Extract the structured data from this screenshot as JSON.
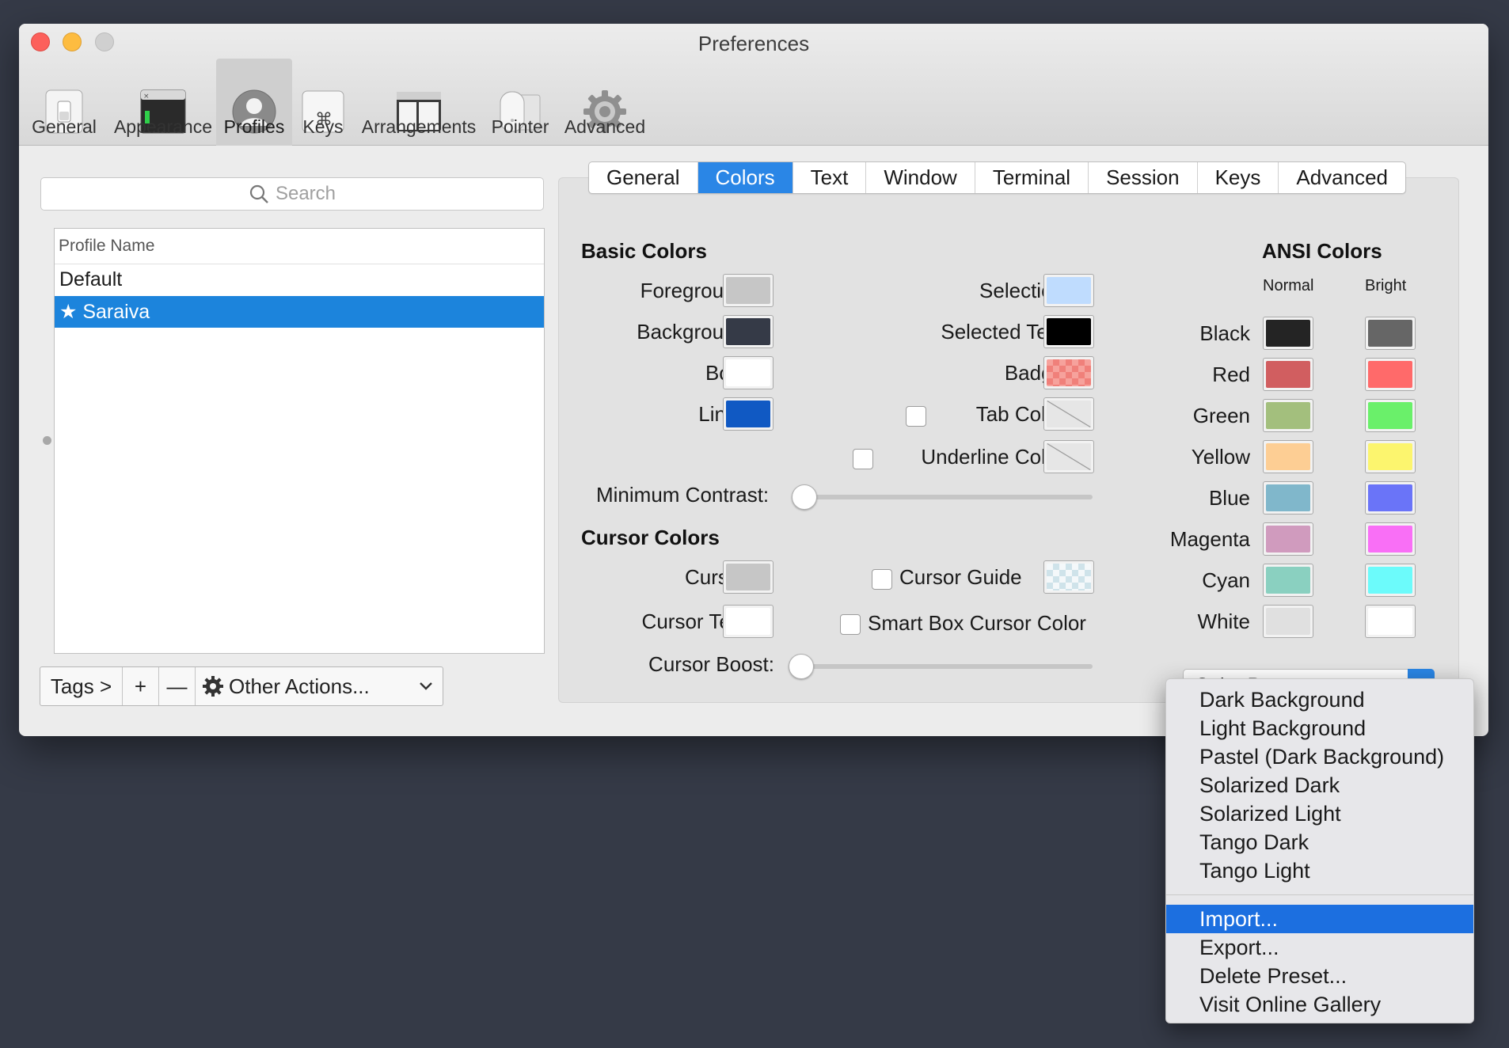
{
  "window": {
    "title": "Preferences"
  },
  "toolbar": [
    {
      "label": "General",
      "icon": "general-switch-icon"
    },
    {
      "label": "Appearance",
      "icon": "terminal-window-icon"
    },
    {
      "label": "Profiles",
      "icon": "user-silhouette-icon",
      "selected": true
    },
    {
      "label": "Keys",
      "icon": "command-key-icon"
    },
    {
      "label": "Arrangements",
      "icon": "window-arrangement-icon"
    },
    {
      "label": "Pointer",
      "icon": "mouse-icon"
    },
    {
      "label": "Advanced",
      "icon": "gear-icon"
    }
  ],
  "search": {
    "placeholder": "Search"
  },
  "profiles": {
    "header": "Profile Name",
    "rows": [
      {
        "name": "Default",
        "selected": false
      },
      {
        "name": "★ Saraiva",
        "selected": true
      }
    ]
  },
  "bottom_bar": {
    "tags": "Tags >",
    "add": "+",
    "remove": "—",
    "other_actions": "Other Actions..."
  },
  "tabs": [
    "General",
    "Colors",
    "Text",
    "Window",
    "Terminal",
    "Session",
    "Keys",
    "Advanced"
  ],
  "active_tab": "Colors",
  "basic_colors": {
    "title": "Basic Colors",
    "left": [
      {
        "label": "Foreground",
        "color": "#c6c6c6"
      },
      {
        "label": "Background",
        "color": "#353a47"
      },
      {
        "label": "Bold",
        "color": "#ffffff"
      },
      {
        "label": "Links",
        "color": "#1059c3"
      }
    ],
    "right": [
      {
        "label": "Selection",
        "color": "#bfdcfe"
      },
      {
        "label": "Selected Text",
        "color": "#000000"
      },
      {
        "label": "Badge",
        "color": "#f0807a",
        "pattern": "checker"
      },
      {
        "label": "Tab Color",
        "checkbox": true,
        "checked": false,
        "pattern": "none"
      },
      {
        "label": "Underline Color",
        "checkbox": true,
        "checked": false,
        "pattern": "none"
      }
    ],
    "min_contrast": {
      "label": "Minimum Contrast:",
      "value": 0
    }
  },
  "cursor_colors": {
    "title": "Cursor Colors",
    "cursor": {
      "label": "Cursor",
      "color": "#c6c6c6"
    },
    "cursor_text": {
      "label": "Cursor Text",
      "color": "#ffffff"
    },
    "cursor_guide": {
      "label": "Cursor Guide",
      "checked": false,
      "color": "#dcecf2",
      "pattern": "checker"
    },
    "smart_box": {
      "label": "Smart Box Cursor Color",
      "checked": false
    },
    "cursor_boost": {
      "label": "Cursor Boost:",
      "value": 0
    }
  },
  "ansi": {
    "title": "ANSI Colors",
    "col_normal": "Normal",
    "col_bright": "Bright",
    "rows": [
      {
        "name": "Black",
        "normal": "#242424",
        "bright": "#666666"
      },
      {
        "name": "Red",
        "normal": "#d15e60",
        "bright": "#ff6a6a"
      },
      {
        "name": "Green",
        "normal": "#a3bf7d",
        "bright": "#6af06a"
      },
      {
        "name": "Yellow",
        "normal": "#fdce94",
        "bright": "#fcf56e"
      },
      {
        "name": "Blue",
        "normal": "#80b7cb",
        "bright": "#6a74f8"
      },
      {
        "name": "Magenta",
        "normal": "#d09bbe",
        "bright": "#f96ff6"
      },
      {
        "name": "Cyan",
        "normal": "#8ad0c0",
        "bright": "#6cfbfb"
      },
      {
        "name": "White",
        "normal": "#e0e0e0",
        "bright": "#ffffff"
      }
    ]
  },
  "presets": {
    "label": "Color Presets...",
    "menu_top": [
      "Dark Background",
      "Light Background",
      "Pastel (Dark Background)",
      "Solarized Dark",
      "Solarized Light",
      "Tango Dark",
      "Tango Light"
    ],
    "menu_bottom": [
      "Import...",
      "Export...",
      "Delete Preset...",
      "Visit Online Gallery"
    ],
    "highlighted": "Import..."
  },
  "colors": {
    "accent": "#2a86e6",
    "selection_row": "#1c84dc",
    "menu_highlight": "#1c6fe0",
    "desktop": "#353a47"
  }
}
